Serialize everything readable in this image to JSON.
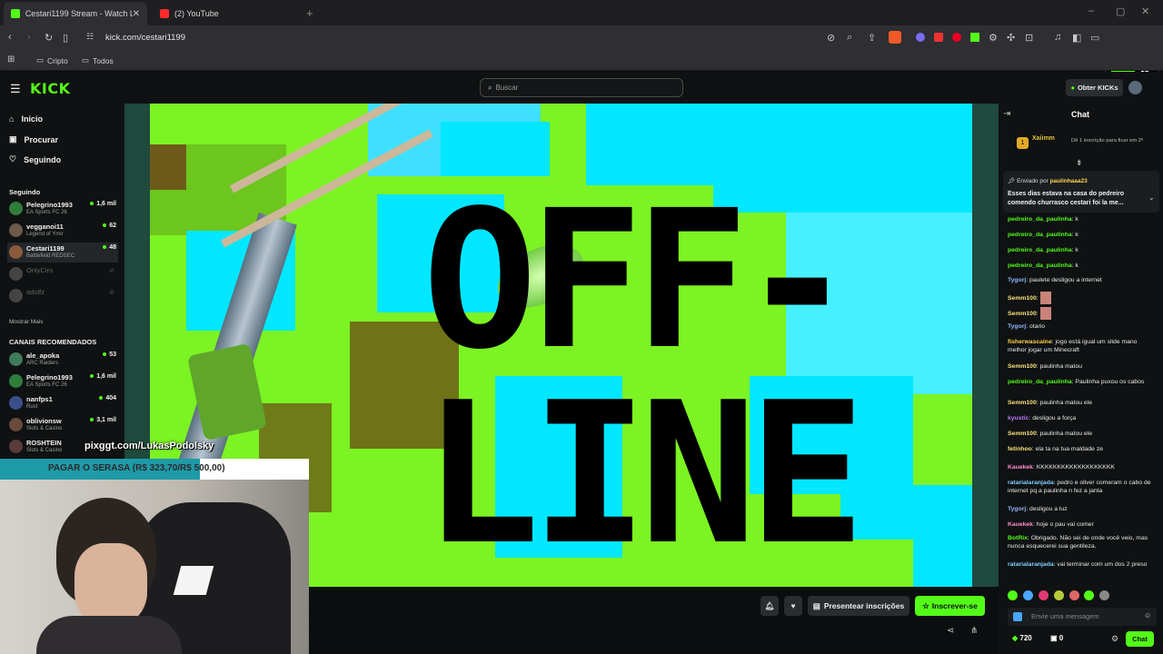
{
  "browser": {
    "tabs": [
      {
        "title": "Cestari1199 Stream - Watch Live",
        "active": true
      },
      {
        "title": "(2) YouTube",
        "active": false
      }
    ],
    "url": "kick.com/cestari1199",
    "bookmarks": [
      "Cripto",
      "Todos"
    ],
    "extension_badge": "6"
  },
  "kick": {
    "logo": "KICK",
    "search_placeholder": "Buscar",
    "get_kicks": "Obter KICKs"
  },
  "sidebar": {
    "nav": [
      "Início",
      "Procurar",
      "Seguindo"
    ],
    "following_title": "Seguindo",
    "following": [
      {
        "name": "Pelegrino1993",
        "category": "EA Sports FC 26",
        "viewers": "1,6 mil",
        "color": "#2f7d3a"
      },
      {
        "name": "vegganoi11",
        "category": "Legend of Ymir",
        "viewers": "62",
        "color": "#6b5a4a"
      },
      {
        "name": "Cestari1199",
        "category": "Battlefield REDSEC",
        "viewers": "48",
        "color": "#8a5a3a"
      },
      {
        "name": "OnlyCiro",
        "category": "",
        "viewers": "",
        "color": "#444"
      },
      {
        "name": "adolfz",
        "category": "",
        "viewers": "",
        "color": "#444"
      }
    ],
    "show_more": "Mostrar Mais",
    "recommended_title": "CANAIS RECOMENDADOS",
    "recommended": [
      {
        "name": "ale_apoka",
        "category": "ARC Raiders",
        "viewers": "53",
        "color": "#3f7a5a"
      },
      {
        "name": "Pelegrino1993",
        "category": "EA Sports FC 26",
        "viewers": "1,6 mil",
        "color": "#2f7d3a"
      },
      {
        "name": "nanfps1",
        "category": "Rust",
        "viewers": "404",
        "color": "#3a4f8a"
      },
      {
        "name": "oblivionsw",
        "category": "Slots & Casino",
        "viewers": "3,1 mil",
        "color": "#6a4a3a"
      },
      {
        "name": "ROSHTEIN",
        "category": "Slots & Casino",
        "viewers": "",
        "color": "#5a3a3a"
      }
    ]
  },
  "video": {
    "offline_line1": "OFF-",
    "offline_line2": "LINE"
  },
  "overlay": {
    "pix_text": "pixggt.com/LukasPodolsky",
    "goal_text": "PAGAR O SERASA (R$ 323,70/R$ 500,00)",
    "goal_progress": 0.647
  },
  "actions": {
    "gift_subs": "Presentear inscrições",
    "subscribe": "Inscrever-se"
  },
  "chat": {
    "title": "Chat",
    "top_user": "Xaiimm",
    "top_hint": "Dê 1 inscrição para ficar em 2º",
    "pinned_by_label": "Enviado por",
    "pinned_by_user": "paulinhaaa23",
    "pinned_text": "Esses dias estava na casa do pedreiro comendo churrasco cestari foi la me...",
    "messages": [
      {
        "user": "pedreiro_da_paulinha",
        "text": "k",
        "color": "#53fc18"
      },
      {
        "user": "pedreiro_da_paulinha",
        "text": "k",
        "color": "#53fc18"
      },
      {
        "user": "pedreiro_da_paulinha",
        "text": "k",
        "color": "#53fc18"
      },
      {
        "user": "pedreiro_da_paulinha",
        "text": "k",
        "color": "#53fc18"
      },
      {
        "user": "Tygorj",
        "text": "paulete desligou a internet",
        "color": "#8fb6ff"
      },
      {
        "user": "Semm100",
        "text": "",
        "color": "#f6e27a"
      },
      {
        "user": "Semm100",
        "text": "",
        "color": "#f6e27a"
      },
      {
        "user": "Tygorj",
        "text": "otario",
        "color": "#8fb6ff"
      },
      {
        "user": "fisherwascaine",
        "text": "jogo está igual um slide mano melhor jogar um Minecraft",
        "color": "#ffd34d"
      },
      {
        "user": "Semm100",
        "text": "paulinha matou",
        "color": "#f6e27a"
      },
      {
        "user": "pedreiro_da_paulinha",
        "text": "Paulinha puxou os cabos",
        "color": "#53fc18"
      },
      {
        "user": "Semm100",
        "text": "paulinha matou ele",
        "color": "#f6e27a"
      },
      {
        "user": "kyustic",
        "text": "desligou a força",
        "color": "#b77cff"
      },
      {
        "user": "Semm100",
        "text": "paulinha matou ele",
        "color": "#f6e27a"
      },
      {
        "user": "fetinhoo",
        "text": "ela ta na tua maldade ze",
        "color": "#f6e27a"
      },
      {
        "user": "Kauekek",
        "text": "KKKKKKKKKKKKKKKKKKK",
        "color": "#ff8bd0"
      },
      {
        "user": "ratarialaranjada",
        "text": "pedro e oliver comeram o cabo de internet pq a paulinha n fez a janta",
        "color": "#7fd1ff"
      },
      {
        "user": "Tygorj",
        "text": "desligou a luz",
        "color": "#8fb6ff"
      },
      {
        "user": "Kauekek",
        "text": "hoje o pau vai comer",
        "color": "#ff8bd0"
      },
      {
        "user": "BotRix",
        "text": "Obrigado. Não sei de onde você veio, mas nunca esquecerei sua gentileza.",
        "color": "#53fc18"
      },
      {
        "user": "ratarialaranjada",
        "text": "vai terminar com um dos 2 preso",
        "color": "#7fd1ff"
      }
    ],
    "input_placeholder": "Envie uma mensagem",
    "kicks_count": "720",
    "points": "0",
    "send_label": "Chat"
  }
}
